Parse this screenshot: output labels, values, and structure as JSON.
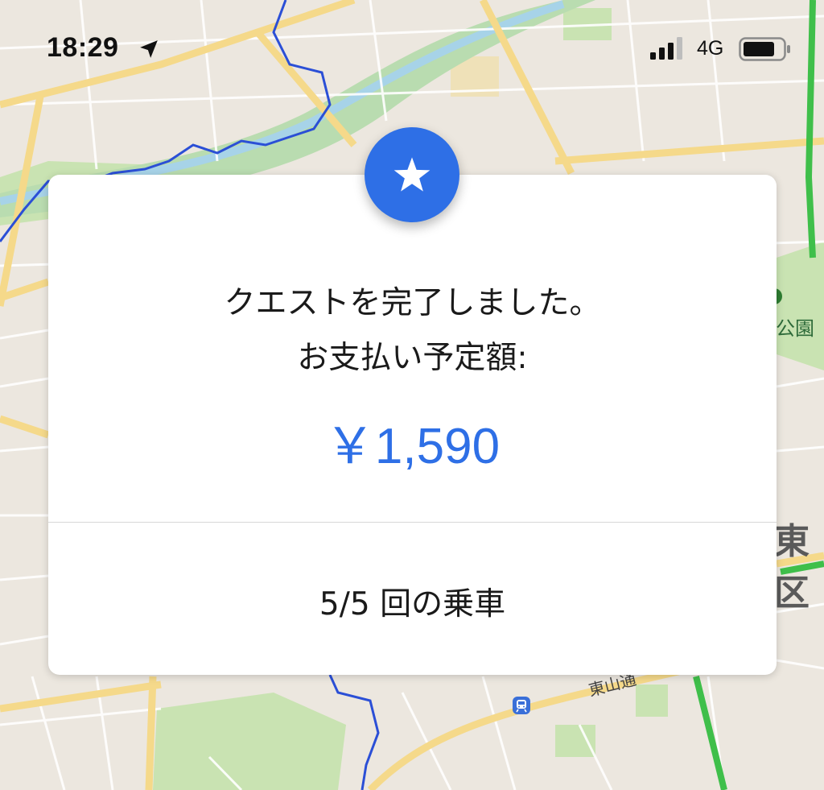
{
  "status_bar": {
    "time": "18:29",
    "network": "4G",
    "icons": [
      "location-arrow-icon",
      "signal-bars-icon",
      "battery-icon"
    ]
  },
  "map": {
    "labels": {
      "park": "公園",
      "district": "東区",
      "road": "東山通"
    },
    "icons": [
      "train-station-icon"
    ]
  },
  "dialog": {
    "badge_icon": "star-icon",
    "message_line1": "クエストを完了しました。",
    "message_line2": "お支払い予定額:",
    "amount": "￥1,590",
    "rides": "5/5 回の乗車"
  },
  "colors": {
    "accent": "#2e6fe6",
    "map_background": "#ece7df",
    "road_major": "#f5d98a",
    "park_green": "#c9e3b2",
    "river": "#a7d3e8",
    "highway": "#3fbf4a",
    "boundary": "#2b4fd6"
  }
}
